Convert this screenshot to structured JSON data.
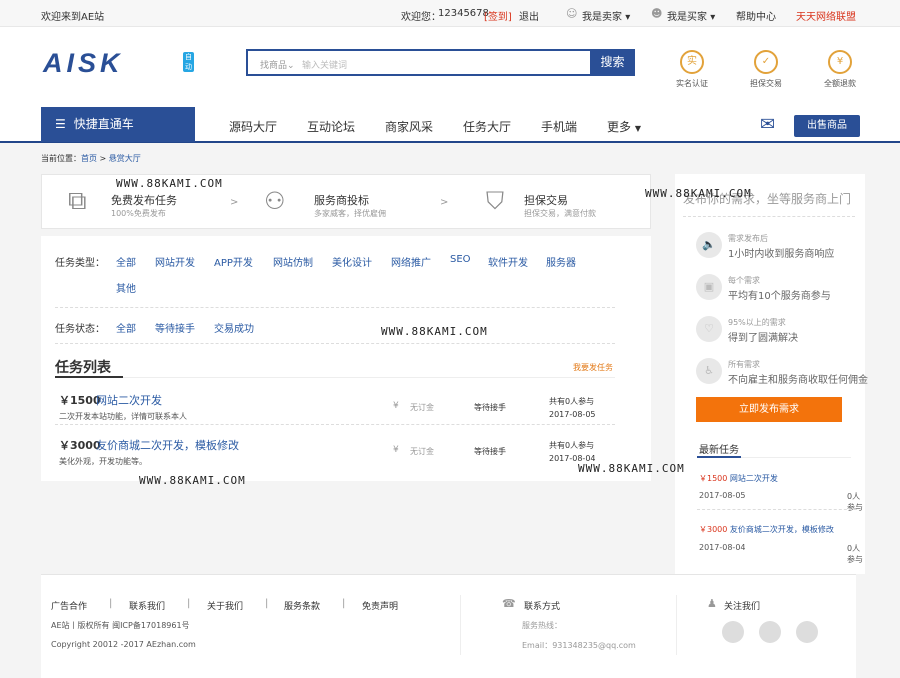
{
  "topbar": {
    "welcome": "欢迎来到AE站",
    "user_prefix": "欢迎您：",
    "username": "12345678",
    "signin": "[签到]",
    "logout": "退出",
    "seller": "我是卖家",
    "buyer": "我是买家",
    "help": "帮助中心",
    "union": "天天网络联盟"
  },
  "header": {
    "logo": "AISK",
    "logo_badge": "自动",
    "search_category": "找商品",
    "search_placeholder": "输入关键词",
    "search_button": "搜索",
    "features": [
      {
        "icon": "实",
        "label": "实名认证"
      },
      {
        "icon": "✓",
        "label": "担保交易"
      },
      {
        "icon": "¥",
        "label": "全额退款"
      }
    ]
  },
  "nav": {
    "quick": "快捷直通车",
    "items": [
      "源码大厅",
      "互动论坛",
      "商家风采",
      "任务大厅",
      "手机端",
      "更多"
    ],
    "sell_button": "出售商品"
  },
  "breadcrumb": {
    "prefix": "当前位置：",
    "home": "首页",
    "sep": ">",
    "current": "悬赏大厅"
  },
  "steps": [
    {
      "title": "免费发布任务",
      "sub": "100%免费发布"
    },
    {
      "title": "服务商投标",
      "sub": "多家威客，择优雇佣"
    },
    {
      "title": "担保交易",
      "sub": "担保交易，满意付款"
    }
  ],
  "filters": {
    "type_label": "任务类型：",
    "types": [
      "全部",
      "网站开发",
      "APP开发",
      "网站仿制",
      "美化设计",
      "网络推广",
      "SEO",
      "软件开发",
      "服务器",
      "其他"
    ],
    "status_label": "任务状态：",
    "statuses": [
      "全部",
      "等待接手",
      "交易成功"
    ]
  },
  "tasks": {
    "heading": "任务列表",
    "publish_link": "我要发任务",
    "rows": [
      {
        "price": "￥1500",
        "title": "网站二次开发",
        "desc": "二次开发本站功能，详情可联系本人",
        "deposit": "无订金",
        "status": "等待接手",
        "participants": "共有0人参与",
        "date": "2017-08-05"
      },
      {
        "price": "￥3000",
        "title": "友价商城二次开发，模板修改",
        "desc": "美化外观，开发功能等。",
        "deposit": "无订金",
        "status": "等待接手",
        "participants": "共有0人参与",
        "date": "2017-08-04"
      }
    ]
  },
  "sidebar": {
    "headline": "发布你的需求，坐等服务商上门",
    "items": [
      {
        "icon": "🔈",
        "small": "需求发布后",
        "big": "1小时内收到服务商响应"
      },
      {
        "icon": "▣",
        "small": "每个需求",
        "big": "平均有10个服务商参与"
      },
      {
        "icon": "♡",
        "small": "95%以上的需求",
        "big": "得到了圆满解决"
      },
      {
        "icon": "♿",
        "small": "所有需求",
        "big": "不向雇主和服务商收取任何佣金"
      }
    ],
    "publish_button": "立即发布需求",
    "latest_heading": "最新任务",
    "latest": [
      {
        "price": "￥1500",
        "title": "网站二次开发",
        "date": "2017-08-05",
        "count": "0人参与"
      },
      {
        "price": "￥3000",
        "title": "友价商城二次开发，模板修改",
        "date": "2017-08-04",
        "count": "0人参与"
      }
    ]
  },
  "watermark": "WWW.88KAMI.COM",
  "footer": {
    "links": [
      "广告合作",
      "联系我们",
      "关于我们",
      "服务条款",
      "免责声明"
    ],
    "icp": "AE站丨版权所有 闽ICP备17018961号",
    "copyright": "Copyright 20012 -2017 AEzhan.com",
    "contact_title": "联系方式",
    "hotline": "服务热线：",
    "email": "Email：931348235@qq.com",
    "follow_title": "关注我们"
  }
}
